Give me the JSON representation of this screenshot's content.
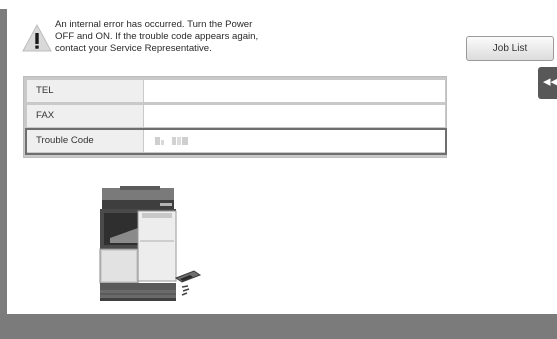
{
  "message": {
    "lines": [
      "An internal error has occurred. Turn the Power",
      "OFF and ON.  If the trouble code appears again,",
      "contact your Service Representative."
    ]
  },
  "job_list": {
    "label": "Job List"
  },
  "side_tab": {
    "glyph": "◂◂"
  },
  "info": {
    "rows": [
      {
        "label": "TEL",
        "value": ""
      },
      {
        "label": "FAX",
        "value": ""
      },
      {
        "label": "Trouble Code",
        "value": ""
      }
    ]
  },
  "icons": {
    "warning": "warning-icon",
    "machine": "mfp-printer-illustration",
    "side_tab": "collapse-panel-icon"
  },
  "colors": {
    "panel_gray": "#c9c9c9",
    "bar_gray": "#7b7b7b",
    "tab_gray": "#585858"
  }
}
